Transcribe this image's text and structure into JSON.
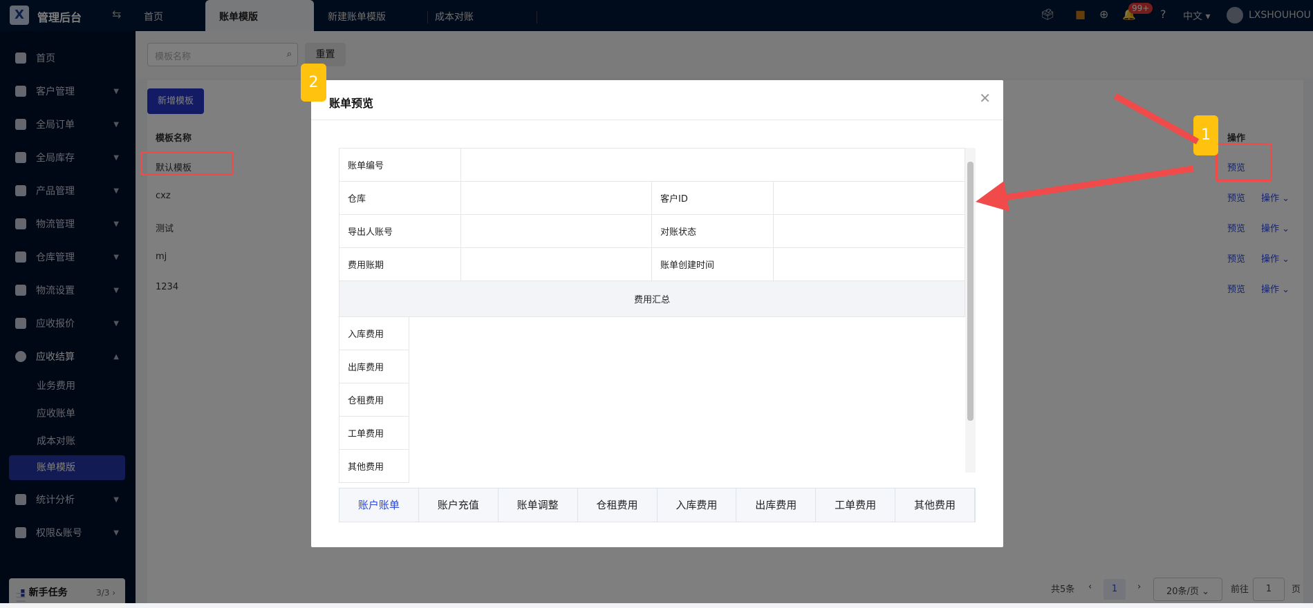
{
  "header": {
    "app_title": "管理后台",
    "tabs": [
      "首页",
      "账单模版",
      "新建账单模版",
      "成本对账"
    ],
    "active_tab": "账单模版",
    "notification_count": "99+",
    "language": "中文",
    "username": "LXSHOUHOU"
  },
  "sidebar": {
    "items": [
      "首页",
      "客户管理",
      "全局订单",
      "全局库存",
      "产品管理",
      "物流管理",
      "仓库管理",
      "物流设置",
      "应收报价",
      "应收结算"
    ],
    "subitems": [
      "业务费用",
      "应收账单",
      "成本对账",
      "账单模版"
    ],
    "items2": [
      "统计分析",
      "权限&账号"
    ],
    "task": {
      "label": "新手任务",
      "count": "3/3"
    }
  },
  "filters": {
    "search_placeholder": "模板名称",
    "reset_label": "重置",
    "add_label": "新增模板"
  },
  "table": {
    "headers": [
      "模板名称",
      "操作"
    ],
    "rows": [
      "默认模板",
      "cxz",
      "测试",
      "mj",
      "1234"
    ],
    "preview_label": "预览",
    "actions_label": "操作"
  },
  "pagination": {
    "total": "共5条",
    "current": "1",
    "page_size": "20条/页",
    "goto_label": "前往",
    "goto_value": "1",
    "page_suffix": "页"
  },
  "modal": {
    "title": "账单预览",
    "fields": [
      "账单编号",
      "仓库",
      "客户ID",
      "导出人账号",
      "对账状态",
      "费用账期",
      "账单创建时间"
    ],
    "summary_title": "费用汇总",
    "fee_items": [
      "入库费用",
      "出库费用",
      "仓租费用",
      "工单费用",
      "其他费用"
    ],
    "tabs": [
      "账户账单",
      "账户充值",
      "账单调整",
      "仓租费用",
      "入库费用",
      "出库费用",
      "工单费用",
      "其他费用"
    ],
    "active_tab": "账户账单"
  },
  "annotations": {
    "step1": "1",
    "step2": "2"
  }
}
